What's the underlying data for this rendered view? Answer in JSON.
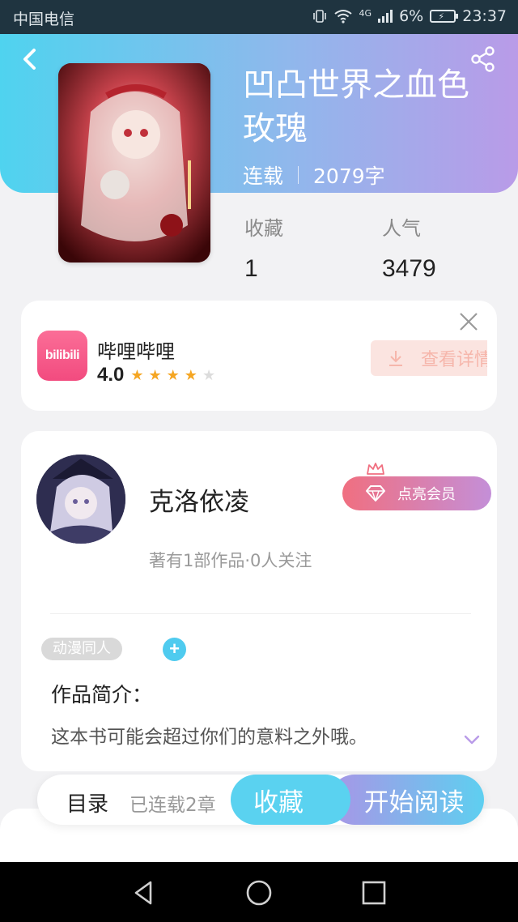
{
  "status_bar": {
    "carrier": "中国电信",
    "network": "4G",
    "battery": "6%",
    "time": "23:37"
  },
  "book": {
    "title": "凹凸世界之血色玫瑰",
    "status": "连载",
    "word_count": "2079字"
  },
  "stats": {
    "favorites_label": "收藏",
    "favorites_value": "1",
    "popularity_label": "人气",
    "popularity_value": "3479"
  },
  "ad": {
    "app_icon_text": "bilibili",
    "app_name": "哔哩哔哩",
    "rating": "4.0",
    "stars": 4,
    "button_label": "查看详情"
  },
  "author": {
    "name": "克洛依凌",
    "vip_label": "点亮会员",
    "meta": "著有1部作品·0人关注"
  },
  "tags": [
    "动漫同人"
  ],
  "tag_add": "+",
  "intro": {
    "title": "作品简介：",
    "text": "这本书可能会超过你们的意料之外哦。"
  },
  "bottom_bar": {
    "toc_label": "目录",
    "chapter_count": "已连载2章",
    "favorite_label": "收藏",
    "read_label": "开始阅读"
  },
  "colors": {
    "accent_cyan": "#4fd3ef",
    "accent_purple": "#b99be8",
    "vip_pink": "#f06f80"
  }
}
